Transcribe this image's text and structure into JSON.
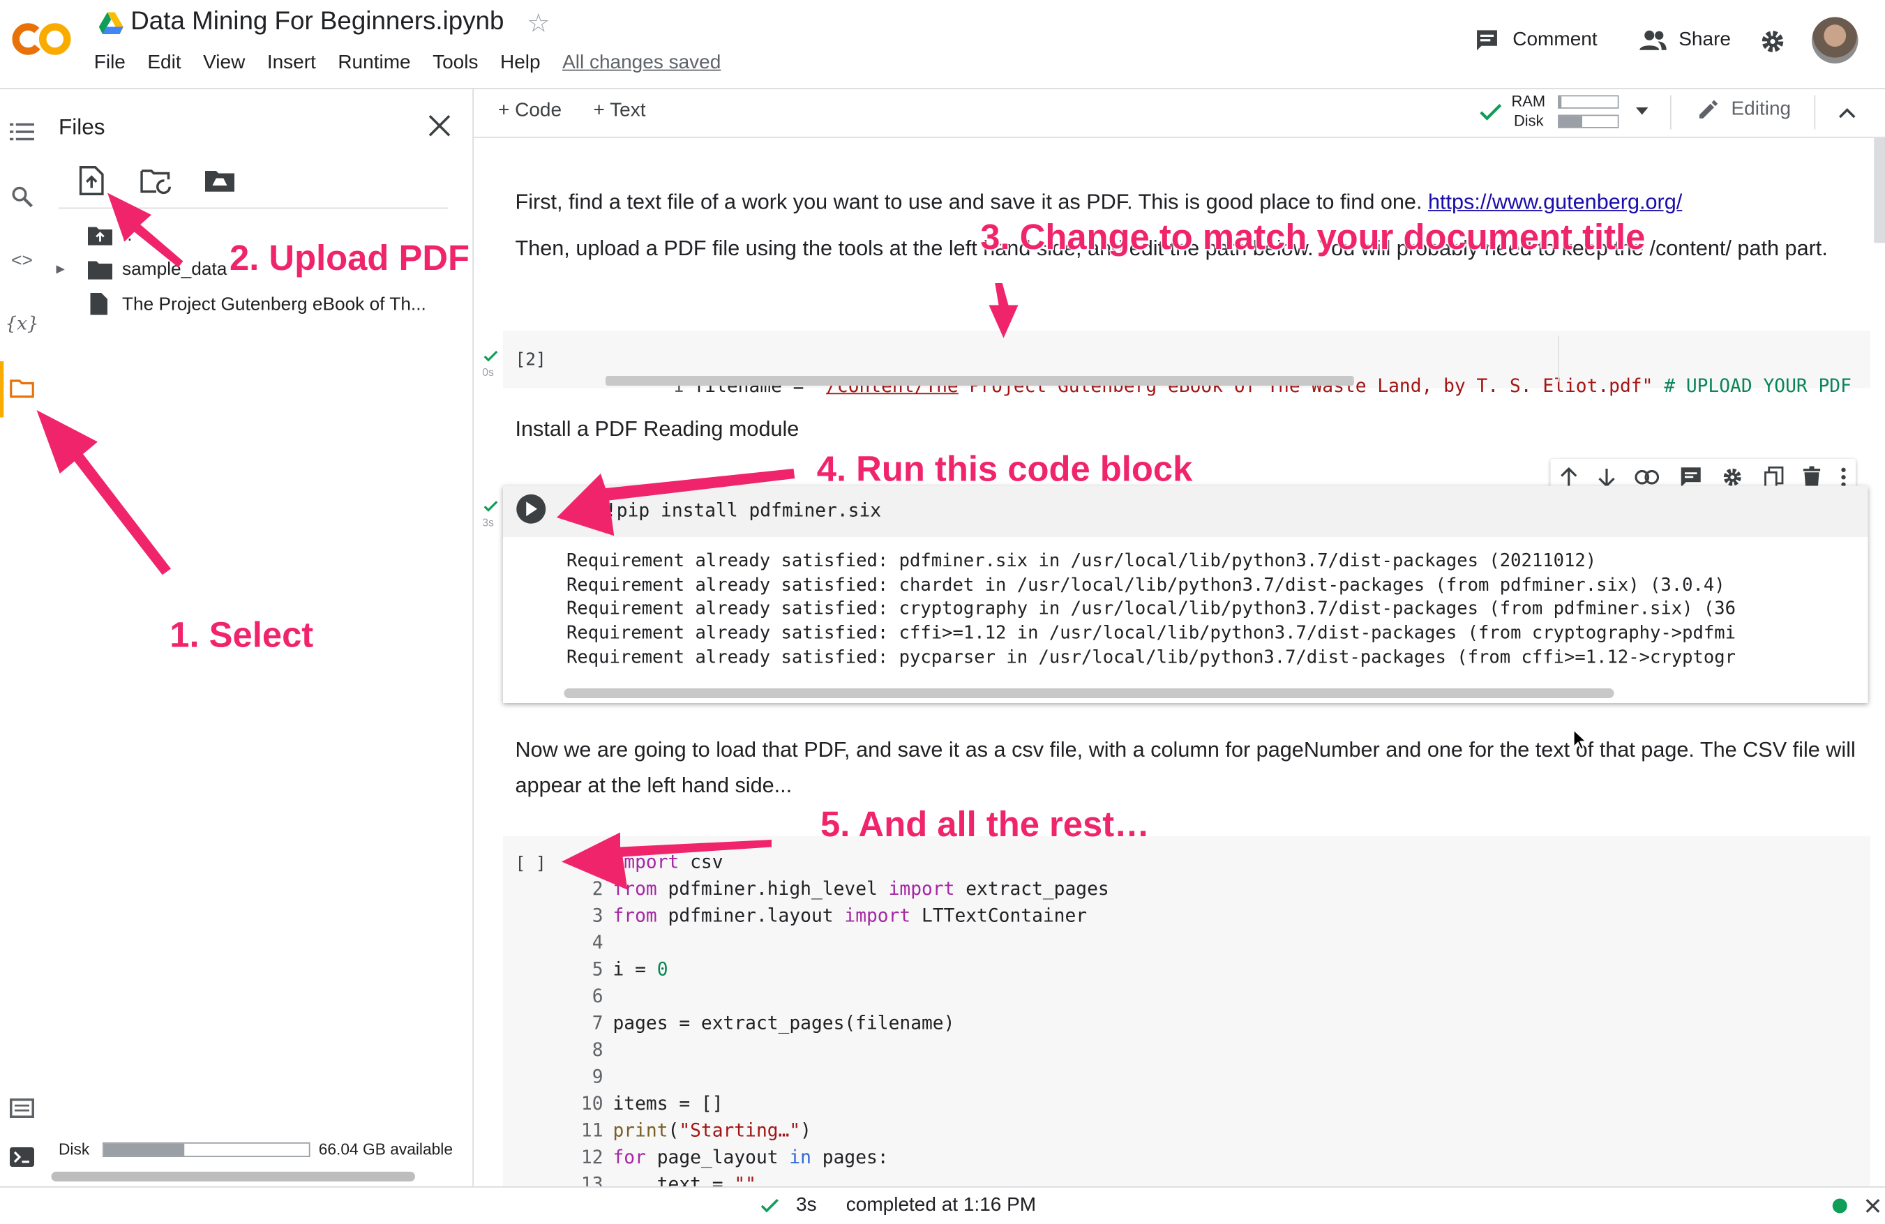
{
  "header": {
    "logo": "CO",
    "title": "Data Mining For Beginners.ipynb",
    "menu": [
      "File",
      "Edit",
      "View",
      "Insert",
      "Runtime",
      "Tools",
      "Help"
    ],
    "save_status": "All changes saved",
    "comment_label": "Comment",
    "share_label": "Share"
  },
  "toolbar": {
    "add_code": "+ Code",
    "add_text": "+ Text",
    "ram_label": "RAM",
    "disk_label": "Disk",
    "editing_label": "Editing"
  },
  "sidebar": {
    "title": "Files",
    "tree": {
      "parent": "..",
      "folder": "sample_data",
      "file": "The Project Gutenberg eBook of Th..."
    },
    "disk_label": "Disk",
    "disk_available": "66.04 GB available"
  },
  "notebook": {
    "text1_prefix": "First, find a text file of a work you want to use and save it as PDF. This is good place to find one. ",
    "text1_link": "https://www.gutenberg.org/",
    "text2": "Then, upload a PDF file using the tools at the left hand side, and edit the path below. You will probably need to keep the /content/ path part.",
    "cell1": {
      "exec_count": "[2]",
      "time": "0s",
      "line_no": "1",
      "code_var": "filename",
      "code_eq": " = ",
      "code_str_a": "\"",
      "code_str_underlined": "/content/The",
      "code_str_b": " Project Gutenberg eBook of The Waste Land, by T. S. Eliot.pdf\"",
      "code_comment": " # UPLOAD YOUR PDF"
    },
    "text3": "Install a PDF Reading module",
    "cell2": {
      "time": "3s",
      "code": "!pip install pdfminer.six",
      "output": [
        "Requirement already satisfied: pdfminer.six in /usr/local/lib/python3.7/dist-packages (20211012)",
        "Requirement already satisfied: chardet in /usr/local/lib/python3.7/dist-packages (from pdfminer.six) (3.0.4)",
        "Requirement already satisfied: cryptography in /usr/local/lib/python3.7/dist-packages (from pdfminer.six) (36",
        "Requirement already satisfied: cffi>=1.12 in /usr/local/lib/python3.7/dist-packages (from cryptography->pdfmi",
        "Requirement already satisfied: pycparser in /usr/local/lib/python3.7/dist-packages (from cffi>=1.12->cryptogr"
      ]
    },
    "text4": "Now we are going to load that PDF, and save it as a csv file, with a column for pageNumber and one for the text of that page. The CSV file will appear at the left hand side...",
    "cell3": {
      "exec_count": "[ ]",
      "lines": [
        {
          "n": "1",
          "code": "import csv"
        },
        {
          "n": "2",
          "code": "from pdfminer.high_level import extract_pages"
        },
        {
          "n": "3",
          "code": "from pdfminer.layout import LTTextContainer"
        },
        {
          "n": "4",
          "code": ""
        },
        {
          "n": "5",
          "code": "i = 0"
        },
        {
          "n": "6",
          "code": ""
        },
        {
          "n": "7",
          "code": "pages = extract_pages(filename)"
        },
        {
          "n": "8",
          "code": ""
        },
        {
          "n": "9",
          "code": ""
        },
        {
          "n": "10",
          "code": "items = []"
        },
        {
          "n": "11",
          "code": "print(\"Starting…\")"
        },
        {
          "n": "12",
          "code": "for page_layout in pages:"
        },
        {
          "n": "13",
          "code": "    text = \"\""
        }
      ]
    }
  },
  "status_bar": {
    "duration": "3s",
    "completed": "completed at 1:16 PM"
  },
  "annotations": {
    "a1": "1. Select",
    "a2": "2. Upload PDF",
    "a3": "3. Change to match your document title",
    "a4": "4. Run this code block",
    "a5": "5. And all the rest…"
  },
  "colors": {
    "annotation": "#f0246b",
    "accent_orange": "#f9ab00",
    "link": "#1a0dab",
    "check_green": "#0f9d58"
  },
  "levels": {
    "ram_usage_fraction": 0.05,
    "disk_usage_fraction": 0.4,
    "sidebar_disk_usage_fraction": 0.39
  }
}
